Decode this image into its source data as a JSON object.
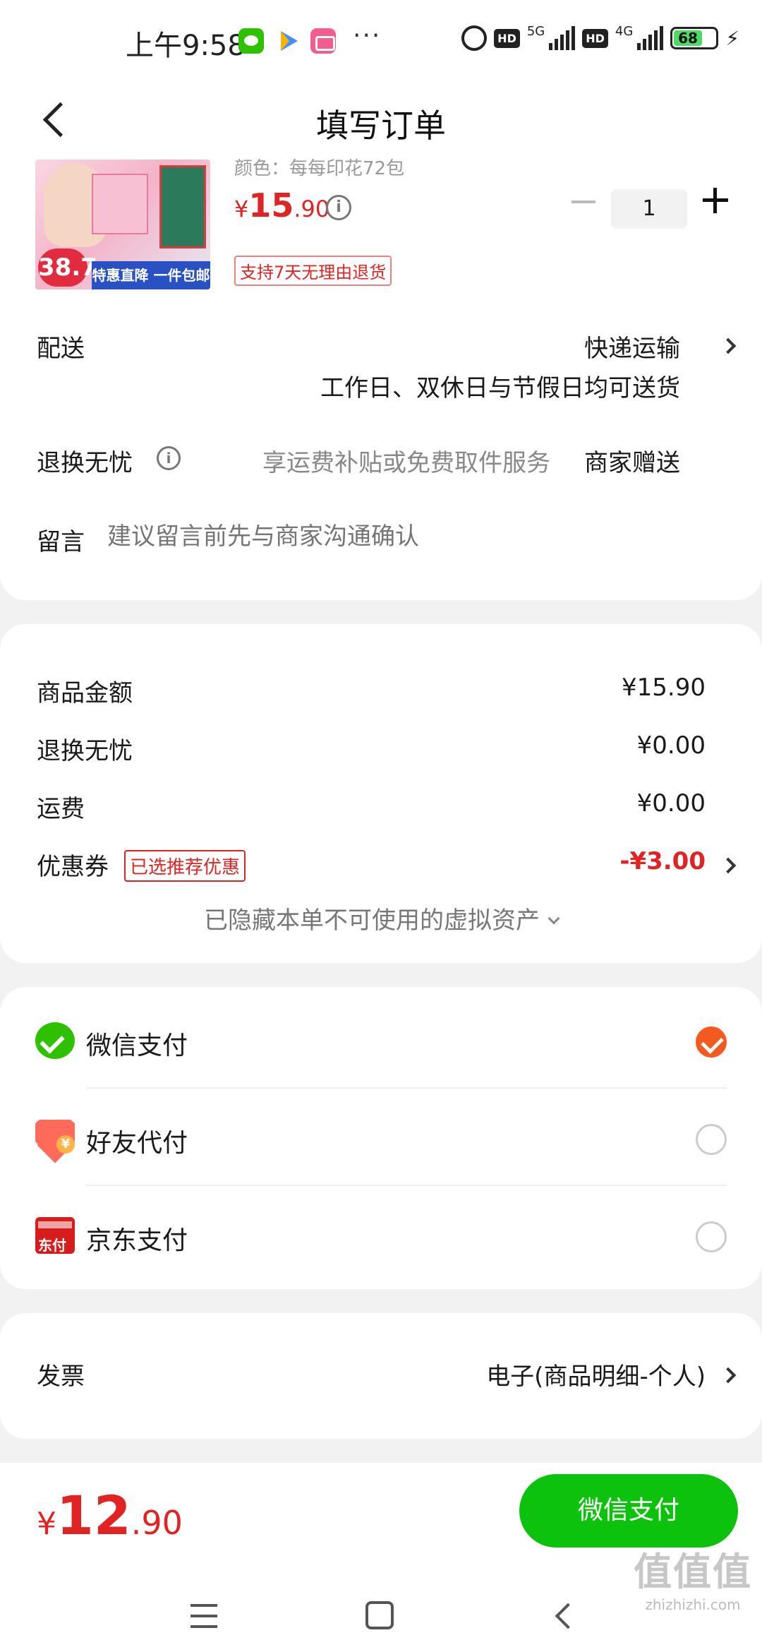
{
  "status_bar": {
    "time": "上午9:58",
    "hd_label": "HD",
    "net1": "5G",
    "net2": "4G",
    "battery": "68",
    "more": "···",
    "icons": [
      "wechat-icon",
      "play-store-icon",
      "bilibili-icon",
      "alarm-icon",
      "signal-icon",
      "battery-icon",
      "charging-icon"
    ]
  },
  "nav": {
    "title": "填写订单",
    "back_icon": "back-arrow-icon"
  },
  "product": {
    "spec": "颜色：每每印花72包",
    "price_currency": "¥",
    "price_int": "15",
    "price_dec": ".90",
    "return_tag": "支持7天无理由退货",
    "quantity": "1",
    "thumb_badge": "38.7",
    "thumb_promo": "特惠直降 一件包邮"
  },
  "delivery": {
    "label": "配送",
    "value": "快递运输",
    "sub": "工作日、双休日与节假日均可送货"
  },
  "return_service": {
    "label": "退换无忧",
    "desc": "享运费补贴或免费取件服务",
    "value": "商家赠送"
  },
  "message": {
    "label": "留言",
    "placeholder": "建议留言前先与商家沟通确认"
  },
  "amounts": {
    "goods_label": "商品金额",
    "goods_value": "¥15.90",
    "return_label": "退换无忧",
    "return_value": "¥0.00",
    "shipping_label": "运费",
    "shipping_value": "¥0.00",
    "coupon_label": "优惠券",
    "coupon_tag": "已选推荐优惠",
    "coupon_value": "-¥3.00",
    "hidden_assets": "已隐藏本单不可使用的虚拟资产"
  },
  "payment": {
    "options": [
      {
        "label": "微信支付",
        "selected": true
      },
      {
        "label": "好友代付",
        "selected": false
      },
      {
        "label": "京东支付",
        "selected": false
      }
    ],
    "jd_icon_text": "东付"
  },
  "invoice": {
    "label": "发票",
    "value": "电子(商品明细-个人)"
  },
  "bottom": {
    "total_currency": "¥",
    "total_int": "12",
    "total_dec": ".90",
    "pay_button": "微信支付"
  },
  "watermark": {
    "line1": "值值值",
    "line2": "zhizhizhi.com"
  },
  "colors": {
    "accent_red": "#e02424",
    "wechat_green": "#0cc20c",
    "check_orange": "#f25a20"
  }
}
